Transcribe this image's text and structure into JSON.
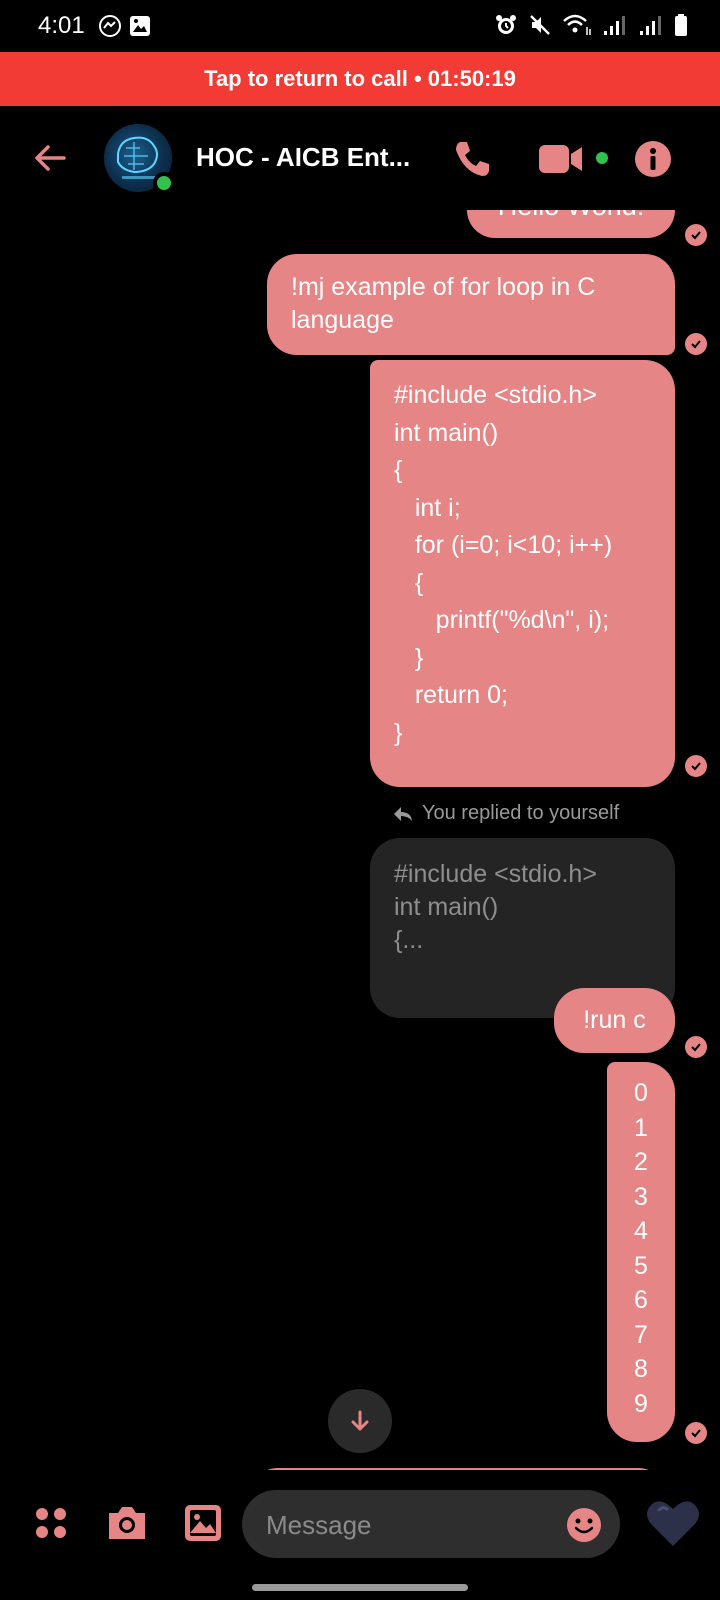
{
  "status_bar": {
    "time": "4:01"
  },
  "call_banner": {
    "text": "Tap to return to call • 01:50:19"
  },
  "header": {
    "title": "HOC - AICB Ent..."
  },
  "messages": {
    "hello": "Hello World!",
    "prompt": "!mj example of for loop in C language",
    "code": [
      "#include <stdio.h>",
      "int main()",
      "{",
      "   int i;",
      "   for (i=0; i<10; i++)",
      "   {",
      "      printf(\"%d\\n\", i);",
      "   }",
      "   return 0;",
      "}"
    ],
    "reply_label": "You replied to yourself",
    "reply_preview": [
      "#include <stdio.h>",
      "int main()",
      "{..."
    ],
    "run": "!run c",
    "output": [
      "0",
      "1",
      "2",
      "3",
      "4",
      "5",
      "6",
      "7",
      "8",
      "9"
    ]
  },
  "composer": {
    "placeholder": "Message"
  },
  "colors": {
    "accent": "#e68585",
    "banner": "#f23b35",
    "online": "#31c24d"
  }
}
